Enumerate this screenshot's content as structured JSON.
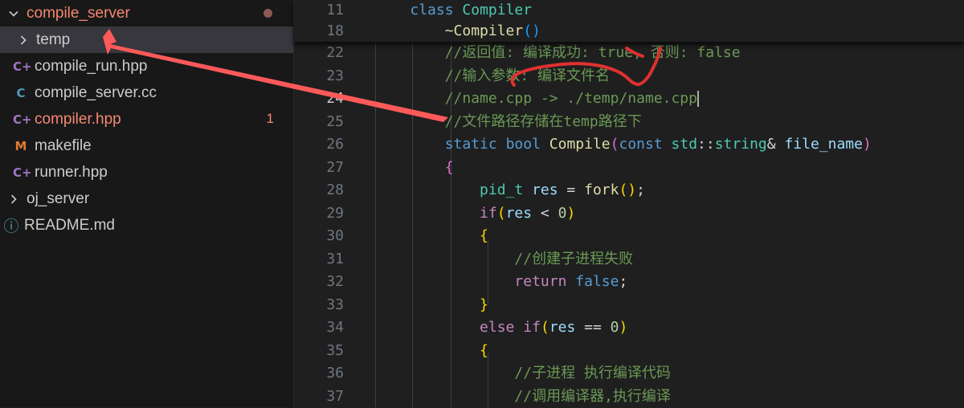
{
  "explorer": {
    "items": [
      {
        "label": "compile_server",
        "kind": "folder-open",
        "color": "#f48771",
        "badge": "dot"
      },
      {
        "label": "temp",
        "kind": "folder-closed",
        "selected": true
      },
      {
        "label": "compile_run.hpp",
        "kind": "cpp-header",
        "icon": "C+"
      },
      {
        "label": "compile_server.cc",
        "kind": "cpp-source",
        "icon": "C"
      },
      {
        "label": "compiler.hpp",
        "kind": "cpp-header",
        "icon": "C+",
        "color": "#f48771",
        "badge": "1"
      },
      {
        "label": "makefile",
        "kind": "makefile",
        "icon": "M"
      },
      {
        "label": "runner.hpp",
        "kind": "cpp-header",
        "icon": "C+"
      },
      {
        "label": "oj_server",
        "kind": "folder-closed"
      },
      {
        "label": "README.md",
        "kind": "info",
        "icon": "ⓘ"
      }
    ]
  },
  "editor": {
    "active_line": "24",
    "sticky_lines": [
      {
        "n": "11",
        "tokens": [
          [
            "    ",
            ""
          ],
          [
            "class",
            "kw"
          ],
          [
            " ",
            ""
          ],
          [
            "Compiler",
            "type"
          ]
        ]
      },
      {
        "n": "18",
        "tokens": [
          [
            "        ",
            ""
          ],
          [
            "~Compiler",
            "fn"
          ],
          [
            "()",
            "p3"
          ]
        ]
      }
    ],
    "lines": [
      {
        "n": "22",
        "tokens": [
          [
            "        ",
            ""
          ],
          [
            "//返回值: 编译成功: true, 否则: false",
            "cm"
          ]
        ]
      },
      {
        "n": "23",
        "tokens": [
          [
            "        ",
            ""
          ],
          [
            "//输入参数: 编译文件名",
            "cm"
          ]
        ]
      },
      {
        "n": "24",
        "tokens": [
          [
            "        ",
            ""
          ],
          [
            "//name.cpp -> ./temp/name.cpp",
            "cm"
          ]
        ],
        "cursor": true
      },
      {
        "n": "25",
        "tokens": [
          [
            "        ",
            ""
          ],
          [
            "//文件路径存储在temp路径下",
            "cm"
          ]
        ]
      },
      {
        "n": "26",
        "tokens": [
          [
            "        ",
            ""
          ],
          [
            "static",
            "kw"
          ],
          [
            " ",
            ""
          ],
          [
            "bool",
            "kw"
          ],
          [
            " ",
            ""
          ],
          [
            "Compile",
            "fn"
          ],
          [
            "(",
            "p2"
          ],
          [
            "const",
            "kw"
          ],
          [
            " ",
            ""
          ],
          [
            "std",
            "type"
          ],
          [
            "::",
            "op"
          ],
          [
            "string",
            "type"
          ],
          [
            "&",
            "op"
          ],
          [
            " ",
            ""
          ],
          [
            "file_name",
            "var"
          ],
          [
            ")",
            "p2"
          ]
        ]
      },
      {
        "n": "27",
        "tokens": [
          [
            "        ",
            ""
          ],
          [
            "{",
            "p2"
          ]
        ]
      },
      {
        "n": "28",
        "tokens": [
          [
            "            ",
            ""
          ],
          [
            "pid_t",
            "type"
          ],
          [
            " ",
            ""
          ],
          [
            "res",
            "var"
          ],
          [
            " = ",
            "op"
          ],
          [
            "fork",
            "fn"
          ],
          [
            "()",
            "p1"
          ],
          [
            ";",
            "op"
          ]
        ]
      },
      {
        "n": "29",
        "tokens": [
          [
            "            ",
            ""
          ],
          [
            "if",
            "ctl"
          ],
          [
            "(",
            "p1"
          ],
          [
            "res",
            "var"
          ],
          [
            " < ",
            "op"
          ],
          [
            "0",
            "num"
          ],
          [
            ")",
            "p1"
          ]
        ]
      },
      {
        "n": "30",
        "tokens": [
          [
            "            ",
            ""
          ],
          [
            "{",
            "p1"
          ]
        ]
      },
      {
        "n": "31",
        "tokens": [
          [
            "                ",
            ""
          ],
          [
            "//创建子进程失败",
            "cm"
          ]
        ]
      },
      {
        "n": "32",
        "tokens": [
          [
            "                ",
            ""
          ],
          [
            "return",
            "ctl"
          ],
          [
            " ",
            ""
          ],
          [
            "false",
            "kw"
          ],
          [
            ";",
            "op"
          ]
        ]
      },
      {
        "n": "33",
        "tokens": [
          [
            "            ",
            ""
          ],
          [
            "}",
            "p1"
          ]
        ]
      },
      {
        "n": "34",
        "tokens": [
          [
            "            ",
            ""
          ],
          [
            "else",
            "ctl"
          ],
          [
            " ",
            ""
          ],
          [
            "if",
            "ctl"
          ],
          [
            "(",
            "p1"
          ],
          [
            "res",
            "var"
          ],
          [
            " == ",
            "op"
          ],
          [
            "0",
            "num"
          ],
          [
            ")",
            "p1"
          ]
        ]
      },
      {
        "n": "35",
        "tokens": [
          [
            "            ",
            ""
          ],
          [
            "{",
            "p1"
          ]
        ]
      },
      {
        "n": "36",
        "tokens": [
          [
            "                ",
            ""
          ],
          [
            "//子进程 执行编译代码",
            "cm"
          ]
        ]
      },
      {
        "n": "37",
        "tokens": [
          [
            "                ",
            ""
          ],
          [
            "//调用编译器,执行编译",
            "cm"
          ]
        ]
      }
    ]
  },
  "annotations": {
    "arrow_color": "#ff5a5a",
    "scribble_color": "#e03030"
  },
  "colors": {
    "sidebar_bg": "#181818",
    "editor_bg": "#1f1f1f",
    "selected_row": "#37373d",
    "git_modified": "#f48771",
    "cpp_icon": "#a074c4",
    "c_icon": "#519aba",
    "makefile_icon": "#e37933",
    "info_icon": "#519aba"
  }
}
